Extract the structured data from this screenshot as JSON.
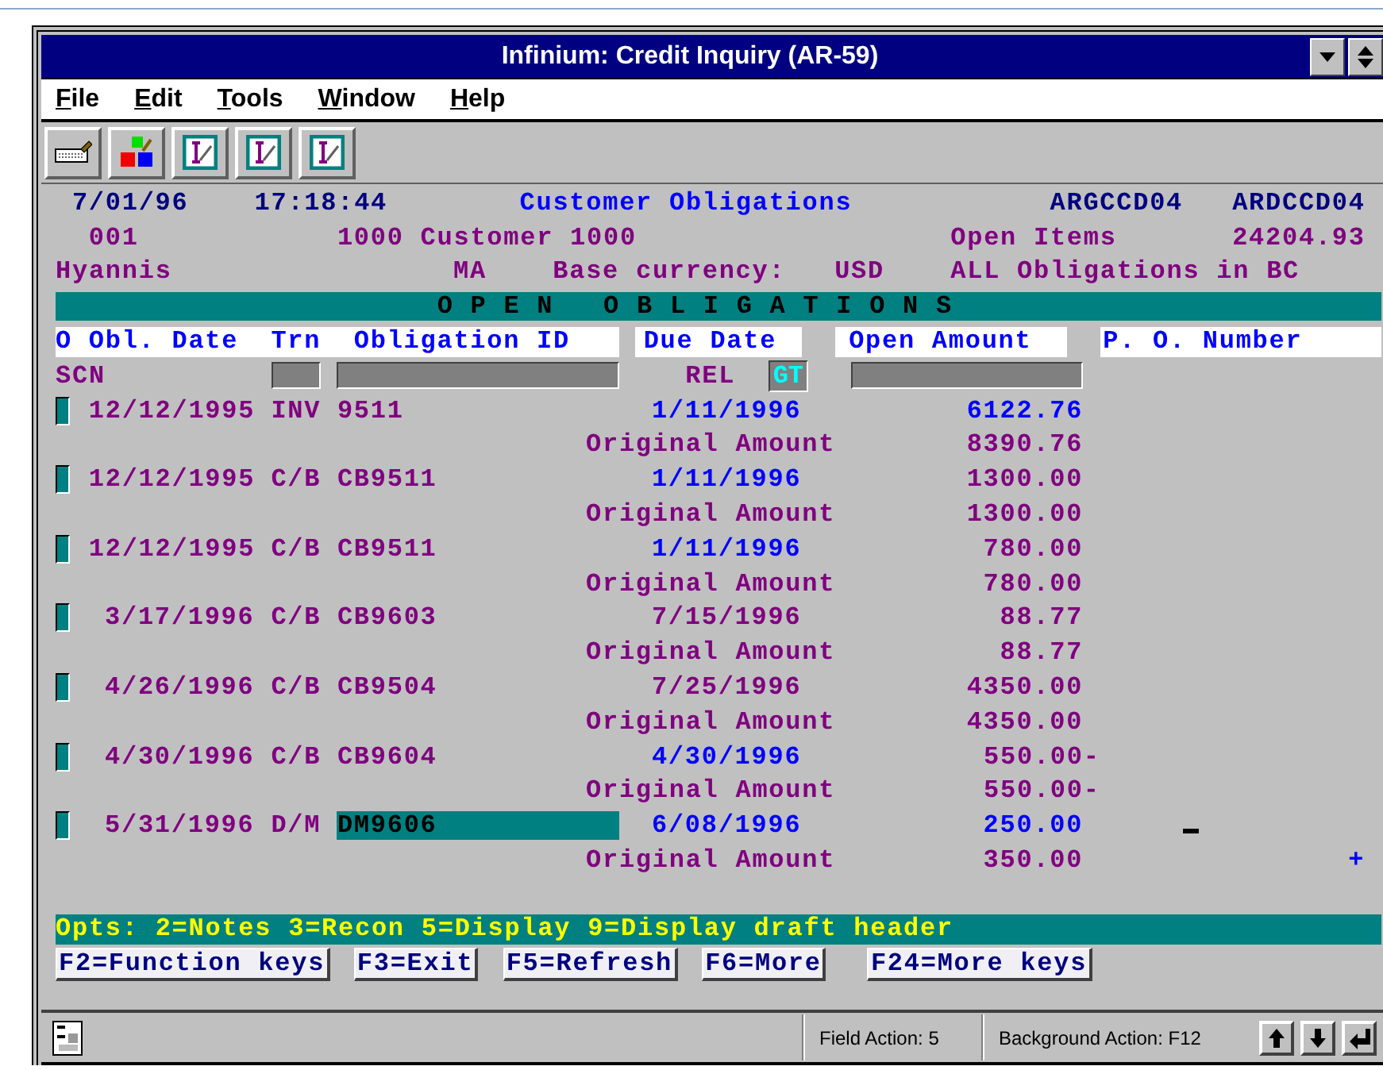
{
  "window": {
    "title": "Infinium: Credit Inquiry (AR-59)"
  },
  "menu": [
    "File",
    "Edit",
    "Tools",
    "Window",
    "Help"
  ],
  "toolbar": [
    {
      "kind": "keyboard"
    },
    {
      "kind": "blocks"
    },
    {
      "kind": "edit"
    },
    {
      "kind": "edit"
    },
    {
      "kind": "edit"
    }
  ],
  "screen": {
    "date": "7/01/96",
    "time": "17:18:44",
    "heading": "Customer Obligations",
    "program_id": "ARGCCD04",
    "display_id": "ARDCCD04",
    "company": "001",
    "customer": "1000 Customer 1000",
    "open_items_label": "Open Items",
    "open_items_total": "24204.93",
    "city": "Hyannis",
    "state": "MA",
    "currency_label": "Base currency:",
    "currency": "USD",
    "scope": "ALL Obligations in BC",
    "section_title": "O P E N   O B L I G A T I O N S",
    "columns": [
      "O",
      "Obl. Date",
      "Trn",
      "Obligation ID",
      "Due Date",
      "Open Amount",
      "P. O. Number"
    ],
    "filter": {
      "label": "SCN",
      "relation_label": "REL",
      "relation": "GT"
    },
    "rows": [
      {
        "date": "12/12/1995",
        "trn": "INV",
        "id": "9511",
        "due": {
          "text": "1/11/1996",
          "color": "#0000ff"
        },
        "open": {
          "text": "6122.76",
          "color": "#0000ff"
        },
        "original_label": "Original Amount",
        "original": "8390.76",
        "focused": false,
        "cursor": false
      },
      {
        "date": "12/12/1995",
        "trn": "C/B",
        "id": "CB9511",
        "due": {
          "text": "1/11/1996",
          "color": "#0000ff"
        },
        "open": {
          "text": "1300.00",
          "color": "#800080"
        },
        "original_label": "Original Amount",
        "original": "1300.00",
        "focused": false,
        "cursor": false
      },
      {
        "date": "12/12/1995",
        "trn": "C/B",
        "id": "CB9511",
        "due": {
          "text": "1/11/1996",
          "color": "#0000ff"
        },
        "open": {
          "text": "780.00",
          "color": "#800080"
        },
        "original_label": "Original Amount",
        "original": "780.00",
        "focused": false,
        "cursor": false
      },
      {
        "date": "3/17/1996",
        "trn": "C/B",
        "id": "CB9603",
        "due": {
          "text": "7/15/1996",
          "color": "#800080"
        },
        "open": {
          "text": "88.77",
          "color": "#800080"
        },
        "original_label": "Original Amount",
        "original": "88.77",
        "focused": false,
        "cursor": false
      },
      {
        "date": "4/26/1996",
        "trn": "C/B",
        "id": "CB9504",
        "due": {
          "text": "7/25/1996",
          "color": "#800080"
        },
        "open": {
          "text": "4350.00",
          "color": "#800080"
        },
        "original_label": "Original Amount",
        "original": "4350.00",
        "focused": false,
        "cursor": false
      },
      {
        "date": "4/30/1996",
        "trn": "C/B",
        "id": "CB9604",
        "due": {
          "text": "4/30/1996",
          "color": "#0000ff"
        },
        "open": {
          "text": "550.00-",
          "color": "#800080"
        },
        "original_label": "Original Amount",
        "original": "550.00-",
        "focused": false,
        "cursor": false
      },
      {
        "date": "5/31/1996",
        "trn": "D/M",
        "id": "DM9606",
        "due": {
          "text": "6/08/1996",
          "color": "#0000ff"
        },
        "open": {
          "text": "250.00",
          "color": "#0000ff"
        },
        "original_label": "Original Amount",
        "original": "350.00",
        "focused": true,
        "cursor": true
      }
    ],
    "more": "+",
    "options": "Opts: 2=Notes 3=Recon 5=Display 9=Display draft header",
    "function_keys": [
      "F2=Function keys",
      "F3=Exit",
      "F5=Refresh",
      "F6=More",
      "F24=More keys"
    ]
  },
  "status_bar": {
    "field_action": "Field Action: 5",
    "background_action": "Background Action: F12"
  }
}
